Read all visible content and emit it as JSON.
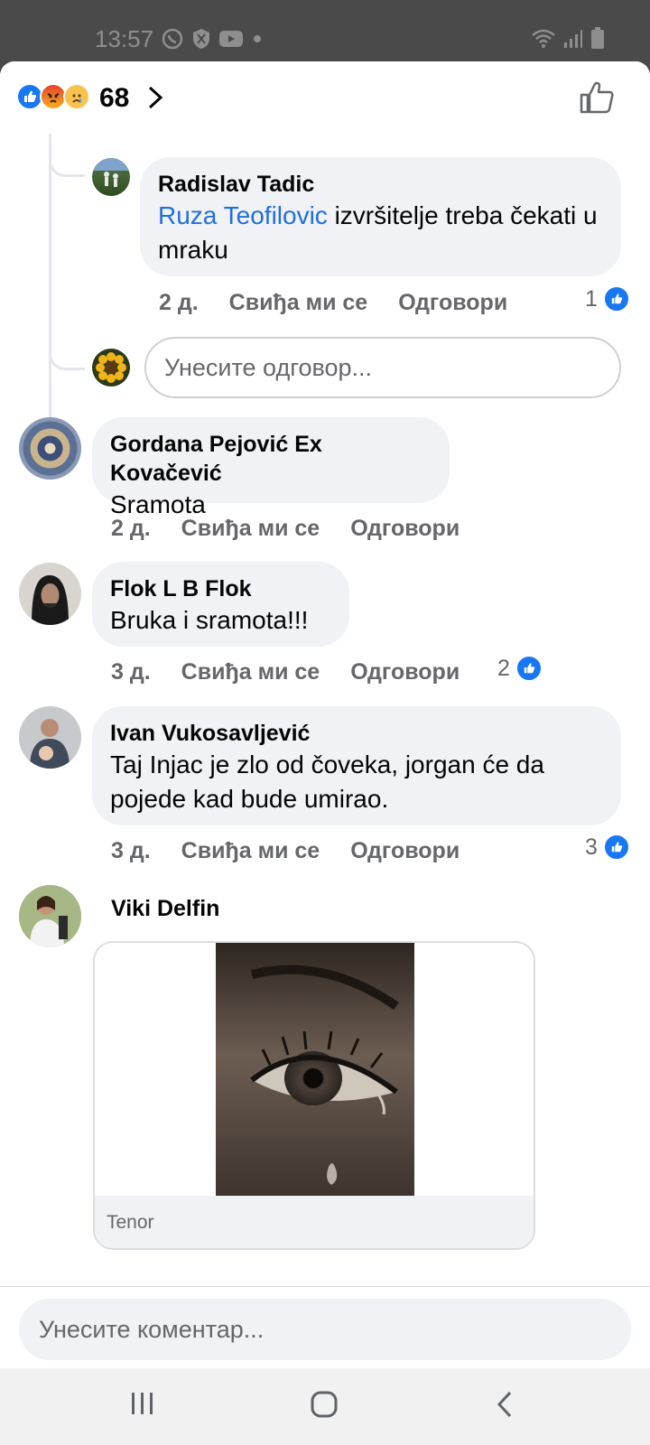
{
  "status_bar": {
    "time": "13:57"
  },
  "header": {
    "reaction_count": "68"
  },
  "comments": [
    {
      "name": "Radislav Tadic",
      "mention": "Ruza Teofilovic",
      "text": " izvršitelje treba čekati u mraku",
      "time": "2 д.",
      "like": "Свиђа ми се",
      "reply": "Одговори",
      "likes": "1"
    },
    {
      "name": "Gordana Pejović Ex Kovačević",
      "text": "Sramota",
      "time": "2 д.",
      "like": "Свиђа ми се",
      "reply": "Одговори"
    },
    {
      "name": "Flok L B Flok",
      "text": "Bruka i sramota!!!",
      "time": "3 д.",
      "like": "Свиђа ми се",
      "reply": "Одговори",
      "likes": "2"
    },
    {
      "name": "Ivan Vukosavljević",
      "text": "Taj Injac je zlo od čoveka, jorgan će da pojede kad bude umirao.",
      "time": "3 д.",
      "like": "Свиђа ми се",
      "reply": "Одговори",
      "likes": "3"
    },
    {
      "name": "Viki Delfin",
      "gif_source": "Tenor"
    }
  ],
  "reply_input": {
    "placeholder": "Унесите одговор..."
  },
  "comment_input": {
    "placeholder": "Унесите коментар..."
  },
  "colors": {
    "accent": "#1877f2",
    "mention": "#216fdb",
    "bubble": "#f0f2f5",
    "meta": "#65676b"
  },
  "icons": [
    "viber-icon",
    "shield-icon",
    "youtube-icon",
    "wifi-icon",
    "signal-icon",
    "battery-icon",
    "like-reaction-icon",
    "angry-reaction-icon",
    "sad-reaction-icon",
    "chevron-right-icon",
    "thumbs-up-icon",
    "recents-icon",
    "home-icon",
    "back-icon"
  ]
}
